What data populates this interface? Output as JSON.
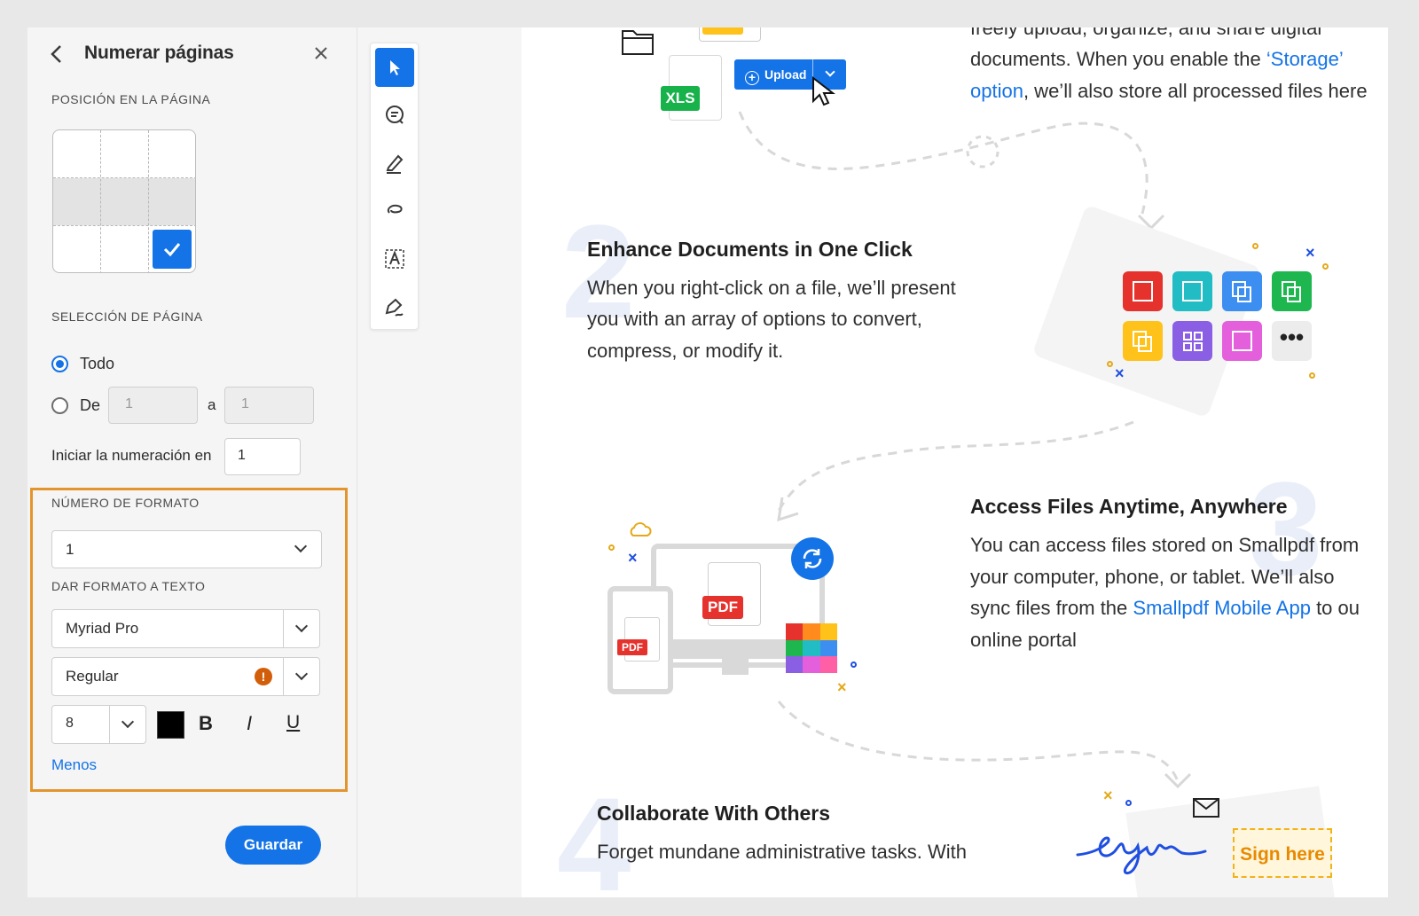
{
  "panel": {
    "title": "Numerar páginas",
    "position_section": "POSICIÓN EN LA PÁGINA",
    "page_selection_section": "SELECCIÓN DE PÁGINA",
    "radio_all": "Todo",
    "radio_from": "De",
    "from_placeholder": "1",
    "to_label": "a",
    "to_placeholder": "1",
    "start_numbering_label": "Iniciar la numeración en",
    "start_numbering_value": "1",
    "format_section": "NÚMERO DE FORMATO",
    "format_value": "1",
    "text_format_section": "DAR FORMATO A TEXTO",
    "font_family": "Myriad Pro",
    "font_style": "Regular",
    "font_size": "8",
    "bold_label": "B",
    "italic_label": "I",
    "underline_label": "U",
    "less_link": "Menos",
    "save_button": "Guardar",
    "text_color": "#000000",
    "highlight_color": "#e3952d",
    "accent": "#1473e6"
  },
  "toolbar": {
    "tools": [
      "select-icon",
      "comment-icon",
      "highlight-pen-icon",
      "lasso-icon",
      "text-box-icon",
      "signature-icon"
    ],
    "selected_tool": "select-icon"
  },
  "document": {
    "section1_text_line1": "freely upload, organize, and share digital",
    "section1_text_line2_pre": "documents. When you enable the ",
    "section1_link1": "‘Storage’",
    "section1_link2": "option",
    "section1_text_line3_post": ", we’ll also store all processed files here",
    "upload_button": "Upload",
    "xls_label": "XLS",
    "section2_number": "2",
    "section2_title": "Enhance Documents in One Click",
    "section2_line1": "When you right-click on a file, we’ll present",
    "section2_line2": "you with an array of options to convert,",
    "section2_line3": "compress, or modify it.",
    "section3_number": "3",
    "section3_title": "Access Files Anytime, Anywhere",
    "section3_line1": "You can access files stored on Smallpdf from",
    "section3_line2": "your computer, phone, or tablet. We’ll also",
    "section3_line3_pre": "sync files from the ",
    "section3_link": "Smallpdf Mobile App",
    "section3_line3_post": " to ou",
    "section3_line4": "online portal",
    "pdf_label_monitor": "PDF",
    "pdf_label_phone": "PDF",
    "section4_number": "4",
    "section4_title": "Collaborate With Others",
    "section4_line1": "Forget mundane administrative tasks. With",
    "sign_here": "Sign here"
  }
}
